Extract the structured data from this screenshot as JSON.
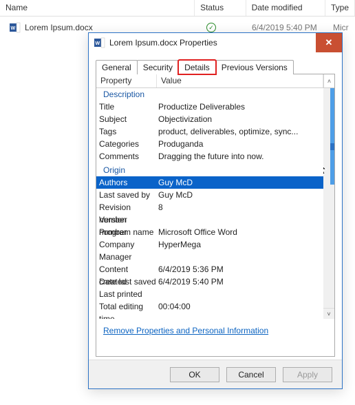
{
  "list": {
    "headers": {
      "name": "Name",
      "status": "Status",
      "date": "Date modified",
      "type": "Type"
    },
    "file": {
      "name": "Lorem Ipsum.docx",
      "date": "6/4/2019 5:40 PM",
      "type": "Micr"
    }
  },
  "dialog": {
    "title": "Lorem Ipsum.docx Properties",
    "tabs": {
      "general": "General",
      "security": "Security",
      "details": "Details",
      "previous": "Previous Versions"
    },
    "grid_header": {
      "property": "Property",
      "value": "Value"
    },
    "groups": {
      "description": "Description",
      "origin": "Origin"
    },
    "props": {
      "title": {
        "label": "Title",
        "value": "Productize Deliverables"
      },
      "subject": {
        "label": "Subject",
        "value": "Objectivization"
      },
      "tags": {
        "label": "Tags",
        "value": "product, deliverables, optimize, sync..."
      },
      "categories": {
        "label": "Categories",
        "value": "Produganda"
      },
      "comments": {
        "label": "Comments",
        "value": "Dragging the future into now."
      },
      "authors": {
        "label": "Authors",
        "value": "Guy McD"
      },
      "last_saved_by": {
        "label": "Last saved by",
        "value": "Guy McD"
      },
      "revision_number": {
        "label": "Revision number",
        "value": "8"
      },
      "version_number": {
        "label": "Version number",
        "value": ""
      },
      "program_name": {
        "label": "Program name",
        "value": "Microsoft Office Word"
      },
      "company": {
        "label": "Company",
        "value": "HyperMega"
      },
      "manager": {
        "label": "Manager",
        "value": ""
      },
      "content_created": {
        "label": "Content created",
        "value": "6/4/2019 5:36 PM"
      },
      "date_last_saved": {
        "label": "Date last saved",
        "value": "6/4/2019 5:40 PM"
      },
      "last_printed": {
        "label": "Last printed",
        "value": ""
      },
      "total_editing": {
        "label": "Total editing time",
        "value": "00:04:00"
      }
    },
    "link": "Remove Properties and Personal Information",
    "buttons": {
      "ok": "OK",
      "cancel": "Cancel",
      "apply": "Apply"
    }
  }
}
